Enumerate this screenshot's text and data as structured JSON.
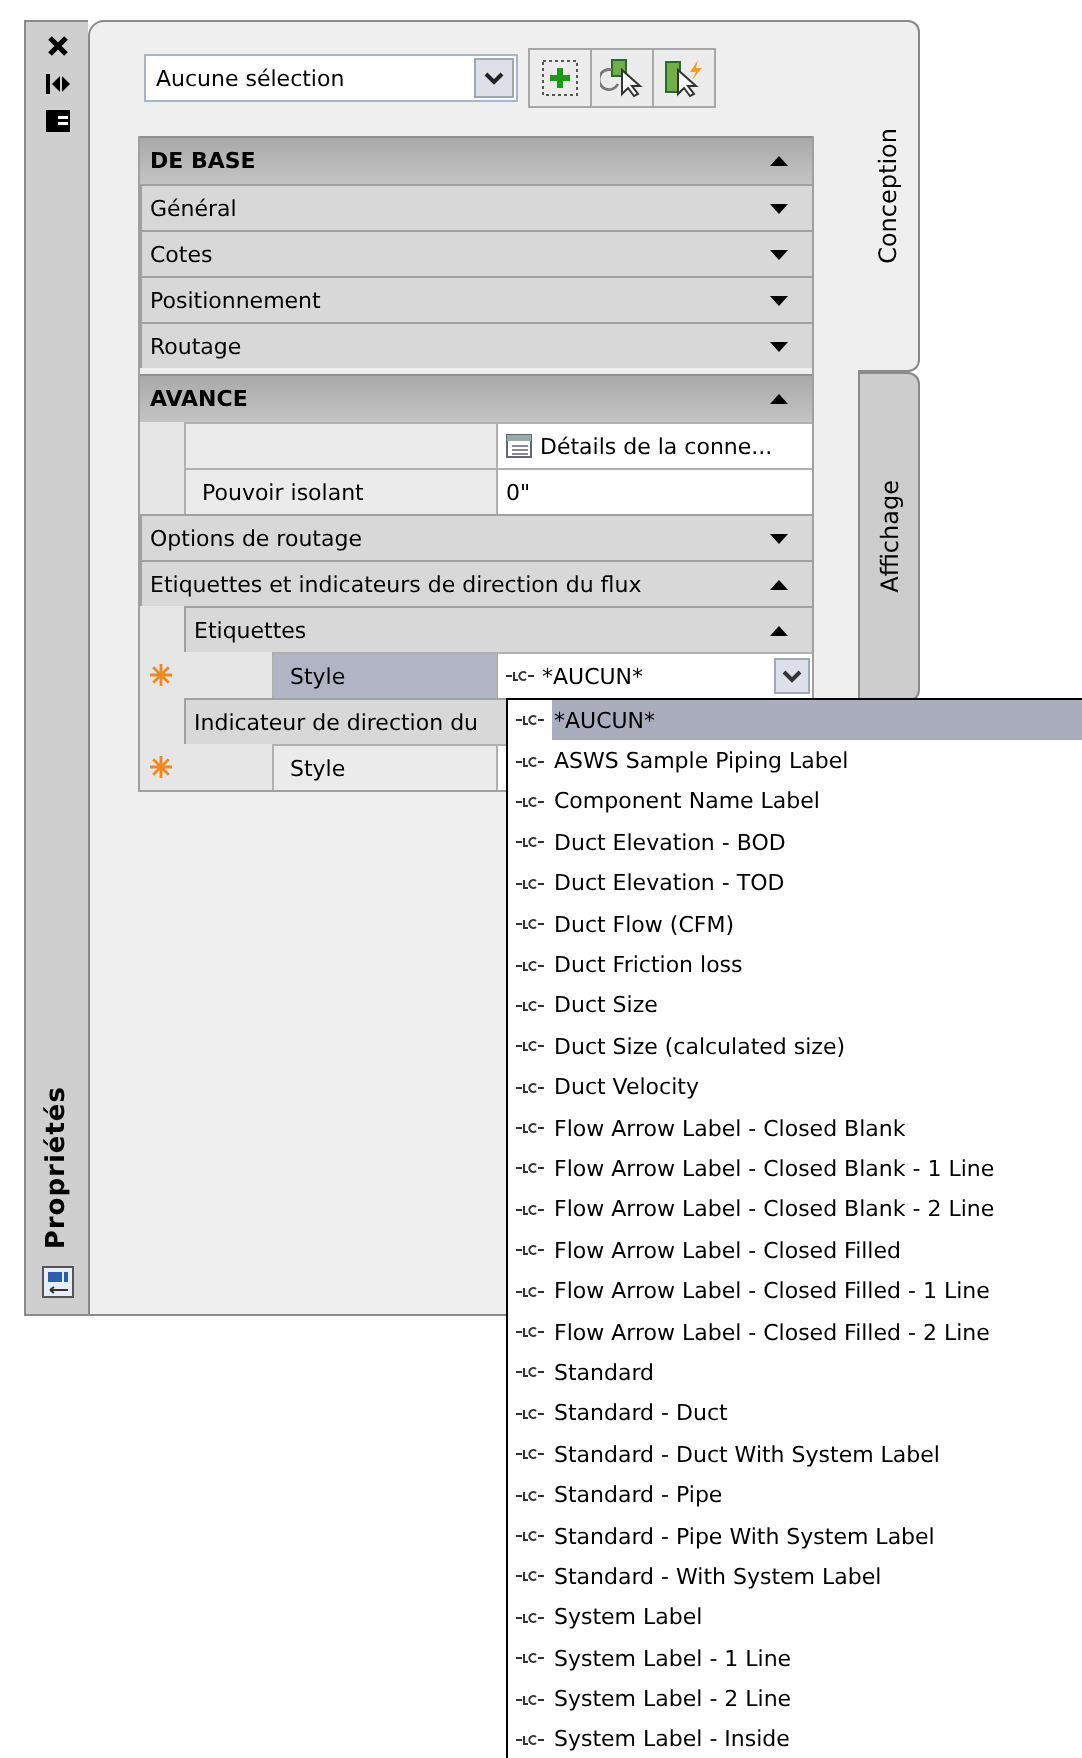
{
  "palette": {
    "title": "Propriétés",
    "selection": "Aucune sélection",
    "tabs": [
      {
        "label": "Conception",
        "selected": true
      },
      {
        "label": "Affichage",
        "selected": false
      }
    ]
  },
  "sections": [
    {
      "title": "DE BASE",
      "expanded": true,
      "children": [
        {
          "kind": "category",
          "label": "Général",
          "expanded": false
        },
        {
          "kind": "category",
          "label": "Cotes",
          "expanded": false
        },
        {
          "kind": "category",
          "label": "Positionnement",
          "expanded": false
        },
        {
          "kind": "category",
          "label": "Routage",
          "expanded": false
        }
      ]
    },
    {
      "title": "AVANCE",
      "expanded": true,
      "children": [
        {
          "kind": "details",
          "value": "Détails de la conne..."
        },
        {
          "kind": "property",
          "label": "Pouvoir isolant",
          "value": "0\"",
          "required": false,
          "selected": false
        },
        {
          "kind": "category",
          "label": "Options de routage",
          "expanded": false
        },
        {
          "kind": "category",
          "label": "Etiquettes et indicateurs de direction du flux",
          "expanded": true,
          "children": [
            {
              "kind": "category",
              "label": "Etiquettes",
              "expanded": true,
              "children": [
                {
                  "kind": "combo",
                  "label": "Style",
                  "value": "*AUCUN*",
                  "required": true,
                  "selected": true
                }
              ]
            },
            {
              "kind": "category",
              "label": "Indicateur de direction du",
              "expanded": true,
              "children": [
                {
                  "kind": "property",
                  "label": "Style",
                  "required": true,
                  "selected": false
                }
              ]
            }
          ]
        }
      ]
    }
  ],
  "dropdown": {
    "options": [
      {
        "label": "*AUCUN*",
        "selected": true
      },
      {
        "label": "ASWS Sample Piping Label",
        "selected": false
      },
      {
        "label": "Component Name Label",
        "selected": false
      },
      {
        "label": "Duct Elevation - BOD",
        "selected": false
      },
      {
        "label": "Duct Elevation - TOD",
        "selected": false
      },
      {
        "label": "Duct Flow (CFM)",
        "selected": false
      },
      {
        "label": "Duct Friction loss",
        "selected": false
      },
      {
        "label": "Duct Size",
        "selected": false
      },
      {
        "label": "Duct Size (calculated size)",
        "selected": false
      },
      {
        "label": "Duct Velocity",
        "selected": false
      },
      {
        "label": "Flow Arrow Label - Closed Blank",
        "selected": false
      },
      {
        "label": "Flow Arrow Label - Closed Blank - 1 Line",
        "selected": false
      },
      {
        "label": "Flow Arrow Label - Closed Blank - 2 Line",
        "selected": false
      },
      {
        "label": "Flow Arrow Label - Closed Filled",
        "selected": false
      },
      {
        "label": "Flow Arrow Label - Closed Filled - 1 Line",
        "selected": false
      },
      {
        "label": "Flow Arrow Label - Closed Filled - 2 Line",
        "selected": false
      },
      {
        "label": "Standard",
        "selected": false
      },
      {
        "label": "Standard - Duct",
        "selected": false
      },
      {
        "label": "Standard - Duct With System Label",
        "selected": false
      },
      {
        "label": "Standard - Pipe",
        "selected": false
      },
      {
        "label": "Standard - Pipe With System Label",
        "selected": false
      },
      {
        "label": "Standard - With System Label",
        "selected": false
      },
      {
        "label": "System Label",
        "selected": false
      },
      {
        "label": "System Label - 1 Line",
        "selected": false
      },
      {
        "label": "System Label - 2 Line",
        "selected": false
      },
      {
        "label": "System Label - Inside",
        "selected": false
      }
    ]
  }
}
